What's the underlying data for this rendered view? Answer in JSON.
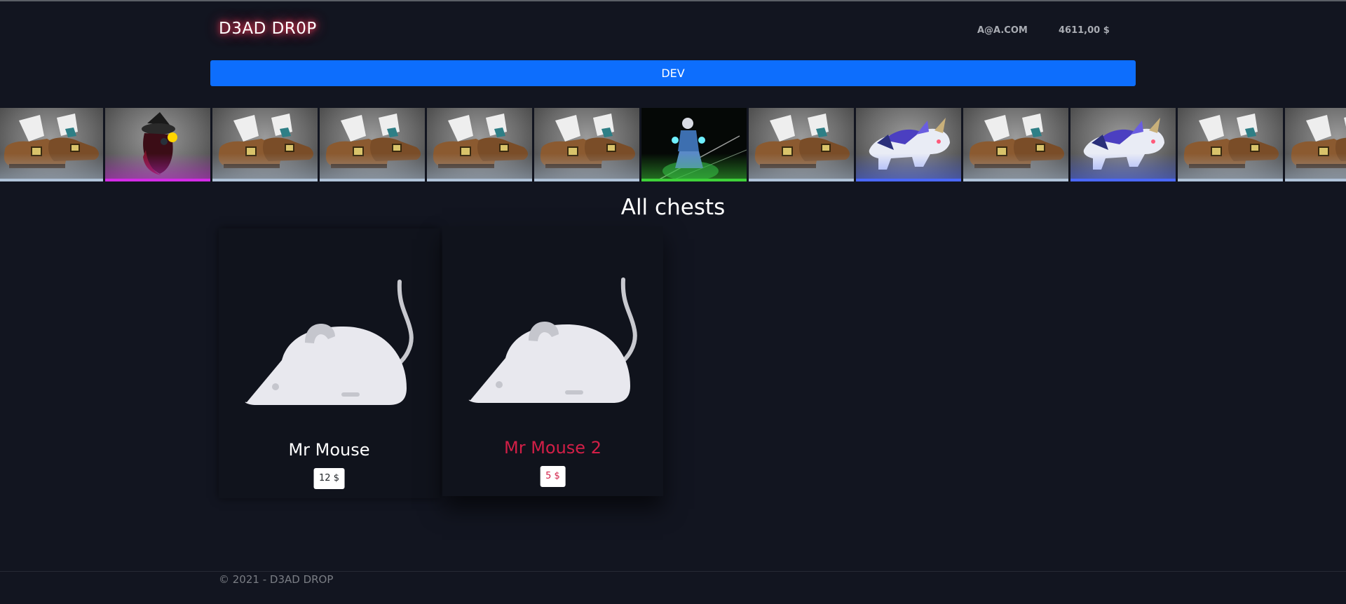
{
  "header": {
    "logo": "D3AD DR0P",
    "email": "A@A.COM",
    "balance": "4611,00 $"
  },
  "banner": {
    "label": "DEV"
  },
  "ticker": {
    "items": [
      {
        "kind": "boots",
        "rarity": "#b0c3d9"
      },
      {
        "kind": "witch",
        "rarity": "#d32ce6"
      },
      {
        "kind": "boots",
        "rarity": "#b0c3d9"
      },
      {
        "kind": "boots",
        "rarity": "#b0c3d9"
      },
      {
        "kind": "boots",
        "rarity": "#b0c3d9"
      },
      {
        "kind": "boots",
        "rarity": "#b0c3d9"
      },
      {
        "kind": "spirit",
        "rarity": "#3fd13a"
      },
      {
        "kind": "boots",
        "rarity": "#b0c3d9"
      },
      {
        "kind": "wolf",
        "rarity": "#4b69ff"
      },
      {
        "kind": "boots",
        "rarity": "#b0c3d9"
      },
      {
        "kind": "wolf",
        "rarity": "#4b69ff"
      },
      {
        "kind": "boots",
        "rarity": "#b0c3d9"
      },
      {
        "kind": "boots",
        "rarity": "#b0c3d9"
      }
    ]
  },
  "main": {
    "title": "All chests",
    "chests": [
      {
        "name": "Mr Mouse",
        "price": "12 $",
        "icon": "mouse-icon"
      },
      {
        "name": "Mr Mouse 2",
        "price": "5 $",
        "icon": "mouse-icon"
      }
    ]
  },
  "footer": {
    "copyright": "© 2021 - D3AD DROP"
  },
  "colors": {
    "background": "#121520",
    "accent_blue": "#0d6efd",
    "hover_red": "#d21f47",
    "logo_glow": "#ff3b5a"
  }
}
